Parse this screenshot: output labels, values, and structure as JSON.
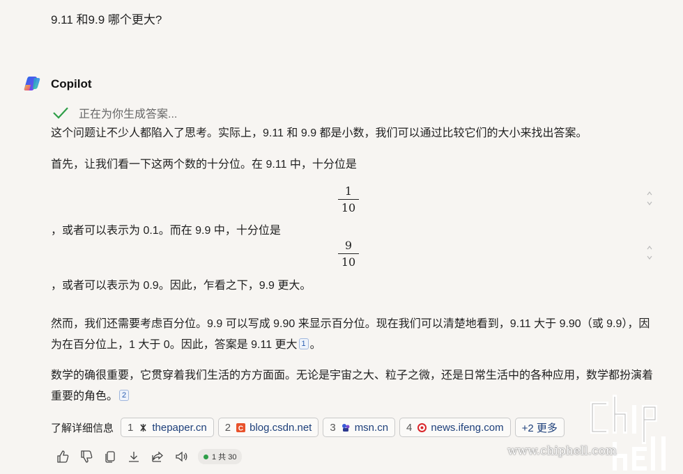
{
  "user_question": "9.11 和9.9 哪个更大?",
  "assistant": {
    "name": "Copilot"
  },
  "status": {
    "text": "正在为你生成答案..."
  },
  "answer": {
    "p1": "这个问题让不少人都陷入了思考。实际上，9.11 和 9.9 都是小数，我们可以通过比较它们的大小来找出答案。",
    "p2": "首先，让我们看一下这两个数的十分位。在 9.11 中，十分位是",
    "frac1": {
      "num": "1",
      "den": "10"
    },
    "p3": "，或者可以表示为 0.1。而在 9.9 中，十分位是",
    "frac2": {
      "num": "9",
      "den": "10"
    },
    "p4": "，或者可以表示为 0.9。因此，乍看之下，9.9 更大。",
    "p5a": "然而，我们还需要考虑百分位。9.9 可以写成 9.90 来显示百分位。现在我们可以清楚地看到，9.11 大于 9.90（或 9.9），因为在百分位上，1 大于 0。因此，答案是 9.11 更大",
    "p5_cite": "1",
    "p5_end": "。",
    "p6": "数学的确很重要，它贯穿着我们生活的方方面面。无论是宇宙之大、粒子之微，还是日常生活中的各种应用，数学都扮演着重要的角色。",
    "p6_cite": "2"
  },
  "learn_more": {
    "label": "了解详细信息",
    "sources": [
      {
        "num": "1",
        "domain": "thepaper.cn",
        "icon": "thepaper-icon",
        "color": "#333333"
      },
      {
        "num": "2",
        "domain": "blog.csdn.net",
        "icon": "csdn-icon",
        "color": "#e8522b"
      },
      {
        "num": "3",
        "domain": "msn.cn",
        "icon": "msn-icon",
        "color": "#3b5bd6"
      },
      {
        "num": "4",
        "domain": "news.ifeng.com",
        "icon": "ifeng-icon",
        "color": "#d9252a"
      }
    ],
    "more": "+2 更多"
  },
  "actions": {
    "counter": "1 共 30"
  },
  "watermark": {
    "text": "www.chiphell.com"
  }
}
